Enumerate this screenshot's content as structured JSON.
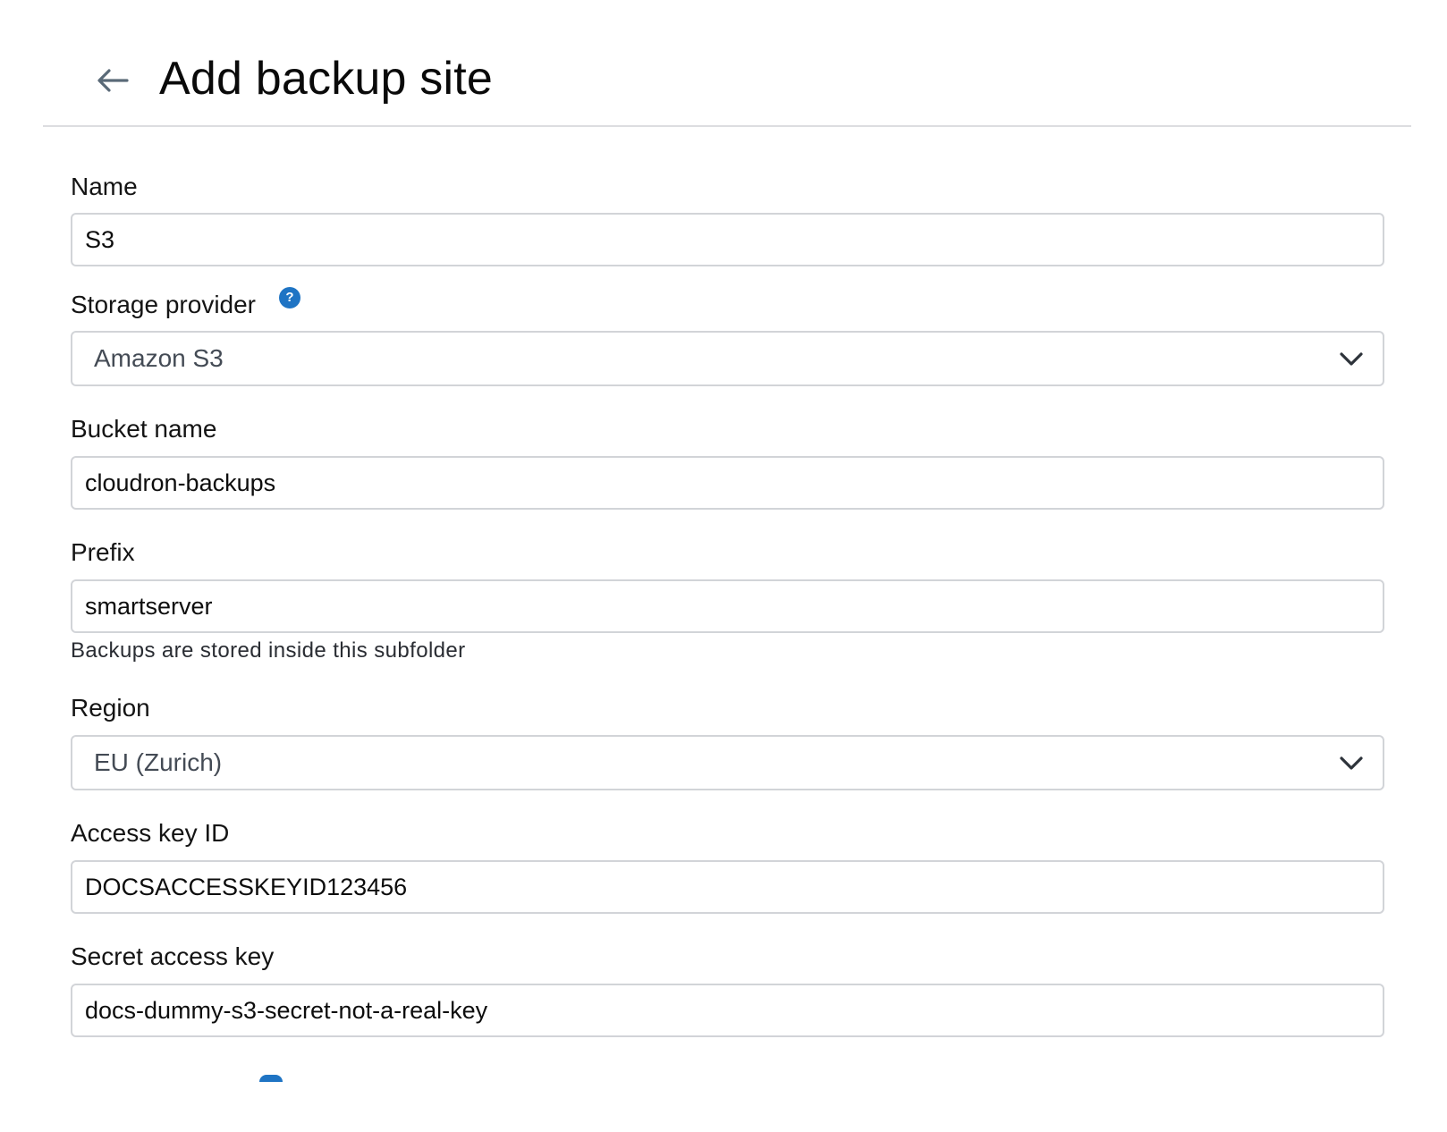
{
  "header": {
    "title": "Add backup site",
    "back_icon": "arrow-left-icon"
  },
  "form": {
    "name": {
      "label": "Name",
      "value": "S3"
    },
    "storage_provider": {
      "label": "Storage provider",
      "help_icon": "question-circle-icon",
      "help_glyph": "?",
      "selected": "Amazon S3"
    },
    "bucket_name": {
      "label": "Bucket name",
      "value": "cloudron-backups"
    },
    "prefix": {
      "label": "Prefix",
      "value": "smartserver",
      "hint": "Backups are stored inside this subfolder"
    },
    "region": {
      "label": "Region",
      "selected": "EU (Zurich)"
    },
    "access_key_id": {
      "label": "Access key ID",
      "value": "DOCSACCESSKEYID123456"
    },
    "secret_access_key": {
      "label": "Secret access key",
      "value": "docs-dummy-s3-secret-not-a-real-key"
    }
  },
  "colors": {
    "accent": "#1f74c4",
    "border": "#d2d4d8",
    "divider": "#dcdde0",
    "icon_gray": "#5a6a78"
  }
}
